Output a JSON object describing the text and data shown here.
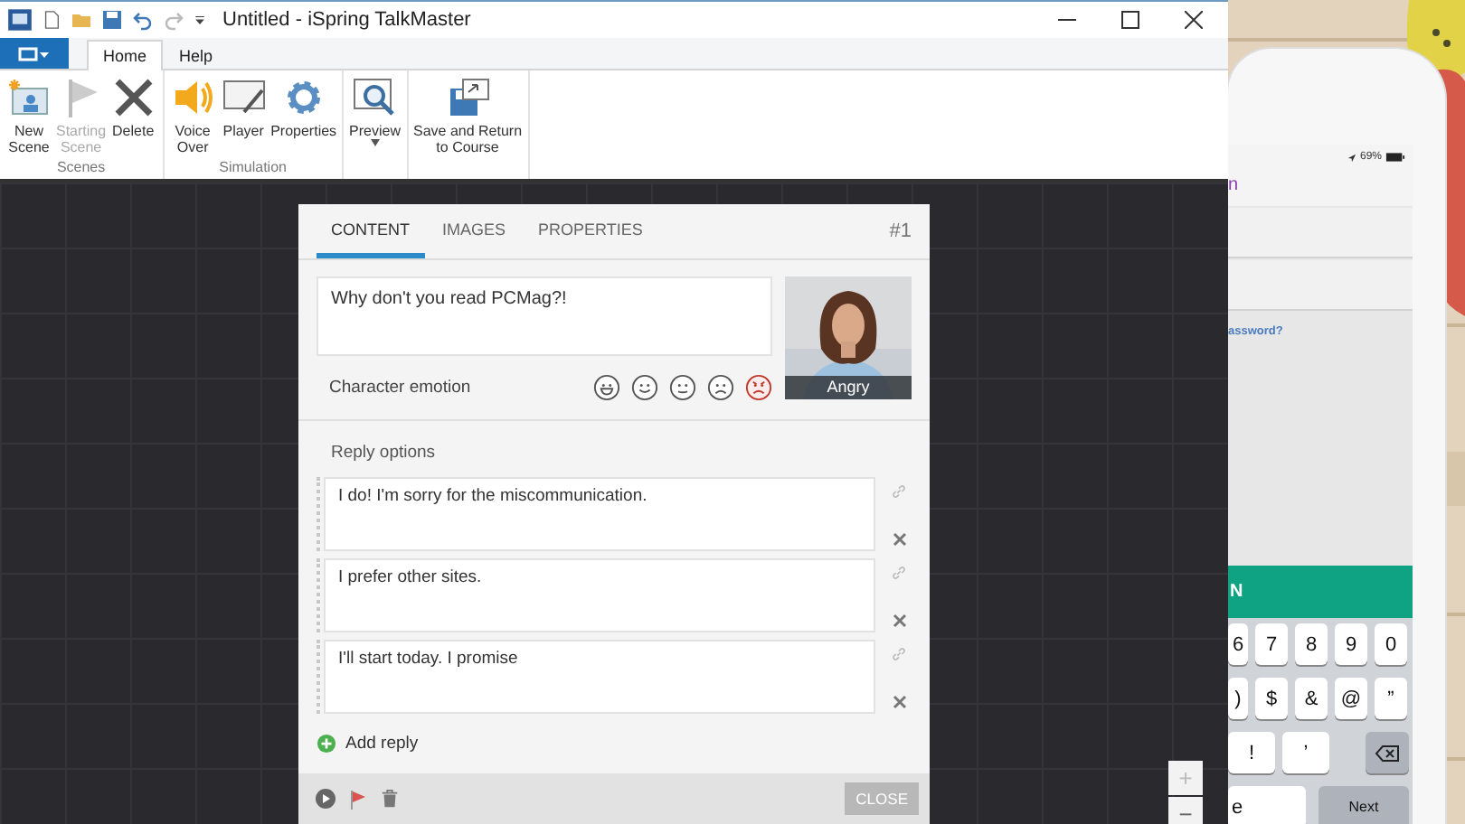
{
  "window": {
    "title": "Untitled - iSpring TalkMaster"
  },
  "ribbon_tabs": [
    {
      "label": "Home",
      "selected": true
    },
    {
      "label": "Help",
      "selected": false
    }
  ],
  "ribbon_groups": [
    {
      "label": "Scenes",
      "buttons": [
        {
          "label": "New\nScene",
          "kind": "new-scene",
          "disabled": false
        },
        {
          "label": "Starting\nScene",
          "kind": "flag",
          "disabled": true
        },
        {
          "label": "Delete",
          "kind": "delete",
          "disabled": false
        }
      ]
    },
    {
      "label": "Simulation",
      "buttons": [
        {
          "label": "Voice\nOver",
          "kind": "speaker",
          "disabled": false
        },
        {
          "label": "Player",
          "kind": "player",
          "disabled": false
        },
        {
          "label": "Properties",
          "kind": "gear",
          "disabled": false
        }
      ]
    },
    {
      "buttons": [
        {
          "label": "Preview",
          "kind": "preview",
          "disabled": false
        }
      ]
    },
    {
      "buttons": [
        {
          "label": "Save and Return\nto Course",
          "kind": "save",
          "disabled": false
        }
      ]
    }
  ],
  "dialog": {
    "tabs": [
      {
        "label": "CONTENT",
        "selected": true
      },
      {
        "label": "IMAGES",
        "selected": false
      },
      {
        "label": "PROPERTIES",
        "selected": false
      }
    ],
    "number": "#1",
    "question": "Why don't you read PCMag?!",
    "emotion_label": "Character emotion",
    "emotions": [
      {
        "kind": "grin",
        "selected": false
      },
      {
        "kind": "smile",
        "selected": false
      },
      {
        "kind": "neutral",
        "selected": false
      },
      {
        "kind": "sad",
        "selected": false
      },
      {
        "kind": "angry",
        "selected": true
      }
    ],
    "character_caption": "Angry",
    "replies_label": "Reply options",
    "replies": [
      {
        "text": "I do! I'm sorry for the miscommunication."
      },
      {
        "text": "I prefer other sites."
      },
      {
        "text": "I'll start today. I promise"
      }
    ],
    "add_reply": "Add reply",
    "close": "CLOSE"
  },
  "zoom": {
    "zoom_in": "+",
    "zoom_out": "−"
  },
  "phone": {
    "battery": "69%",
    "heading": "n",
    "forgot_link": "assword?",
    "sign_in_button": "N",
    "keyboard": [
      [
        {
          "label": "6",
          "kind": "edge"
        },
        {
          "label": "7",
          "kind": "char"
        },
        {
          "label": "8",
          "kind": "char"
        },
        {
          "label": "9",
          "kind": "char"
        },
        {
          "label": "0",
          "kind": "char"
        }
      ],
      [
        {
          "label": ")",
          "kind": "edge"
        },
        {
          "label": "$",
          "kind": "char"
        },
        {
          "label": "&",
          "kind": "char"
        },
        {
          "label": "@",
          "kind": "char"
        },
        {
          "label": "”",
          "kind": "char"
        }
      ],
      [
        {
          "label": "!",
          "kind": "wide"
        },
        {
          "label": "’",
          "kind": "wide"
        },
        {
          "kind": "backspace"
        }
      ],
      [
        {
          "label": "e",
          "kind": "space"
        },
        {
          "label": "Next",
          "kind": "action"
        }
      ]
    ]
  }
}
